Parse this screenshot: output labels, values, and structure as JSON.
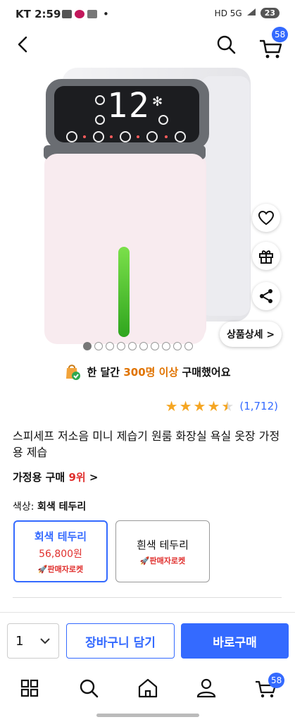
{
  "status": {
    "carrier_time": "KT 2:59",
    "dot": "•",
    "network": "HD 5G",
    "battery": "23"
  },
  "header": {
    "cart_count": "58"
  },
  "gallery": {
    "detail_button": "상품상세 >",
    "image_count": 10,
    "active_index": 0
  },
  "purchase_info": {
    "prefix": "한 달간 ",
    "highlight": "300명 이상",
    "suffix": " 구매했어요"
  },
  "rating": {
    "stars": 4.5,
    "count": "(1,712)"
  },
  "product": {
    "title": "스피세프 저소음 미니 제습기 원룸 화장실 욕실 옷장 가정용 제습",
    "rank_prefix": "가정용 구매 ",
    "rank_value": "9위",
    "rank_suffix": " >"
  },
  "color": {
    "label": "색상: ",
    "selected": "회색 테두리"
  },
  "options": [
    {
      "name": "회색 테두리",
      "price": "56,800원",
      "tag": "판매자로켓"
    },
    {
      "name": "흰색 테두리",
      "tag": "판매자로켓"
    }
  ],
  "display": {
    "digits": "12"
  },
  "buybar": {
    "qty": "1",
    "cart_label": "장바구니 담기",
    "buy_label": "바로구매"
  },
  "tabbar": {
    "cart_count": "58"
  },
  "colors": {
    "accent": "#346aff",
    "price": "#e0302e",
    "orange": "#e07300"
  }
}
